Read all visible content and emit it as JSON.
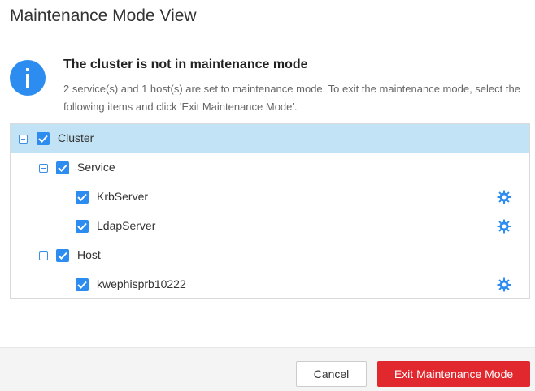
{
  "dialog": {
    "title": "Maintenance Mode View"
  },
  "info": {
    "icon": "info-icon",
    "heading": "The cluster is not in maintenance mode",
    "description": "2 service(s) and 1 host(s) are set to maintenance mode. To exit the maintenance mode, select the following items and click 'Exit Maintenance Mode'."
  },
  "tree": {
    "cluster": {
      "label": "Cluster",
      "checked": true,
      "expanded": true,
      "selected": true
    },
    "service": {
      "label": "Service",
      "checked": true,
      "expanded": true
    },
    "services": [
      {
        "label": "KrbServer",
        "checked": true,
        "action_icon": "gear-icon"
      },
      {
        "label": "LdapServer",
        "checked": true,
        "action_icon": "gear-icon"
      }
    ],
    "host": {
      "label": "Host",
      "checked": true,
      "expanded": true
    },
    "hosts": [
      {
        "label": "kwephisprb10222",
        "checked": true,
        "action_icon": "gear-icon"
      }
    ]
  },
  "footer": {
    "cancel_label": "Cancel",
    "exit_label": "Exit Maintenance Mode"
  },
  "colors": {
    "accent": "#2d8cf0",
    "selected_row": "#c2e2f6",
    "primary_button": "#e0282e"
  }
}
